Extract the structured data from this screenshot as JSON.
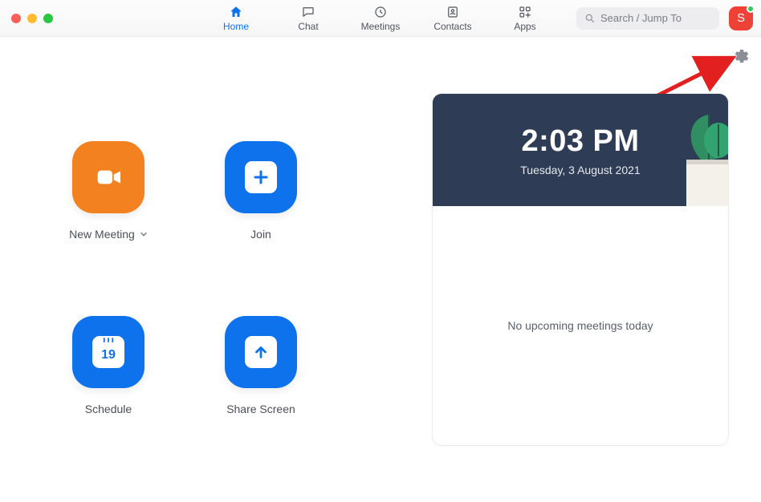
{
  "nav": {
    "home": {
      "label": "Home"
    },
    "chat": {
      "label": "Chat"
    },
    "meetings": {
      "label": "Meetings"
    },
    "contacts": {
      "label": "Contacts"
    },
    "apps": {
      "label": "Apps"
    }
  },
  "search": {
    "placeholder": "Search / Jump To"
  },
  "profile": {
    "initial": "S"
  },
  "actions": {
    "new_meeting": {
      "label": "New Meeting"
    },
    "join": {
      "label": "Join"
    },
    "schedule": {
      "label": "Schedule",
      "calendar_day": "19"
    },
    "share_screen": {
      "label": "Share Screen"
    }
  },
  "clock": {
    "time": "2:03 PM",
    "date": "Tuesday, 3 August 2021"
  },
  "upcoming": {
    "empty_text": "No upcoming meetings today"
  }
}
